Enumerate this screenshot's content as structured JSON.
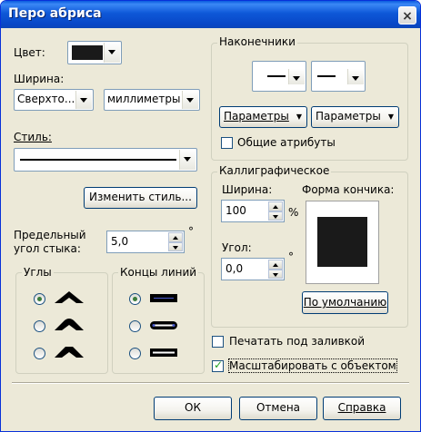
{
  "window": {
    "title": "Перо абриса",
    "close_glyph": "×"
  },
  "left": {
    "color_label": "Цвет:",
    "color_value": "#1a1a1a",
    "width_label": "Ширина:",
    "width_value": "Сверхто...",
    "units_value": "миллиметры",
    "style_label": "Стиль:",
    "edit_style_button": "Изменить стиль...",
    "miter_label_line1": "Предельный",
    "miter_label_line2": "угол стыка:",
    "miter_value": "5,0",
    "degree_sign": "°",
    "corners_title": "Углы",
    "line_caps_title": "Концы линий"
  },
  "arrows": {
    "title": "Наконечники",
    "options_button_left": "Параметры",
    "options_button_right": "Параметры",
    "shared_attrs_label": "Общие атрибуты",
    "shared_attrs_checked": false
  },
  "calligraphy": {
    "title": "Каллиграфическое",
    "width_label": "Ширина:",
    "width_value": "100",
    "percent": "%",
    "angle_label": "Угол:",
    "angle_value": "0,0",
    "degree_sign": "°",
    "nib_shape_label": "Форма кончика:",
    "default_button": "По умолчанию"
  },
  "options": {
    "behind_fill_label": "Печатать под заливкой",
    "behind_fill_checked": false,
    "scale_with_object_label": "Масштабировать с объектом",
    "scale_with_object_checked": true
  },
  "footer": {
    "ok": "ОК",
    "cancel": "Отмена",
    "help": "Справка"
  }
}
